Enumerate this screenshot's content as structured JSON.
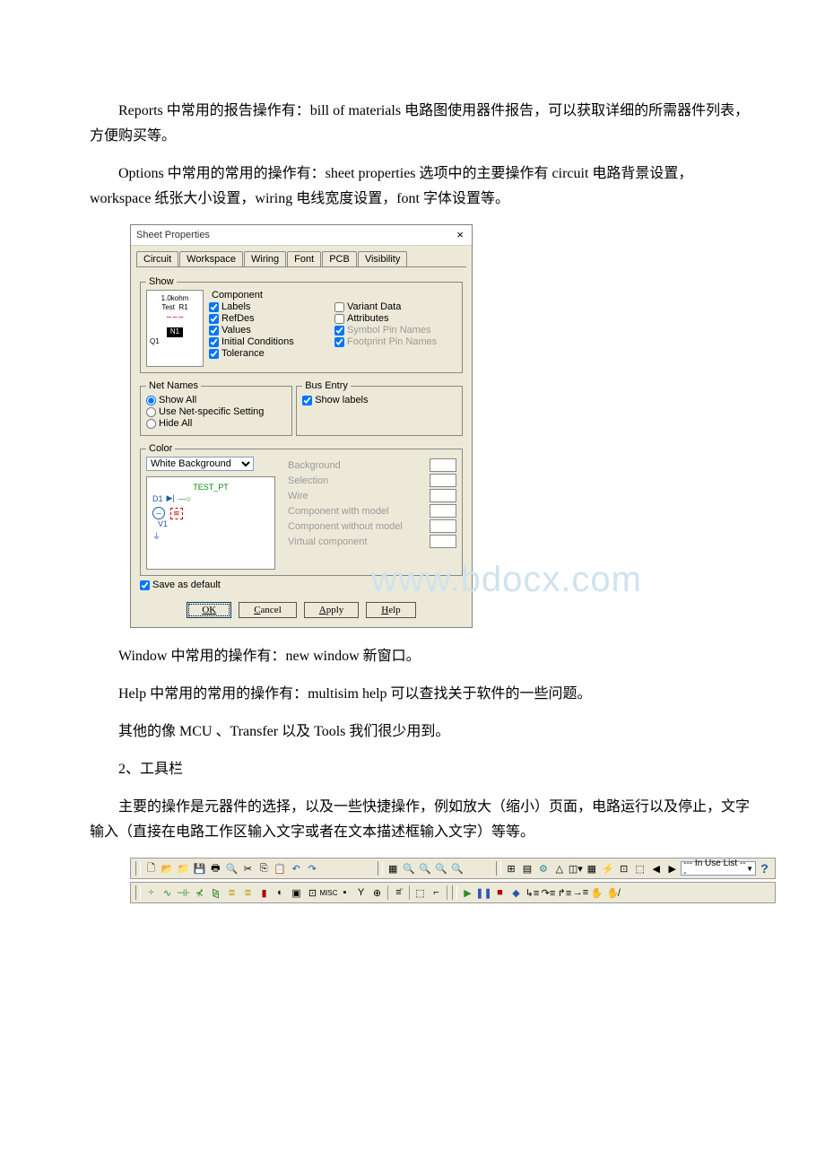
{
  "paras": {
    "p1": "Reports 中常用的报告操作有：bill of materials 电路图使用器件报告，可以获取详细的所需器件列表，方便购买等。",
    "p2": "Options 中常用的常用的操作有：sheet properties 选项中的主要操作有 circuit 电路背景设置，workspace 纸张大小设置，wiring 电线宽度设置，font 字体设置等。",
    "p3": "Window 中常用的操作有：new window 新窗口。",
    "p4": "Help 中常用的常用的操作有：multisim help 可以查找关于软件的一些问题。",
    "p5": "其他的像 MCU 、Transfer 以及 Tools 我们很少用到。",
    "p6": "2、工具栏",
    "p7": "主要的操作是元器件的选择，以及一些快捷操作，例如放大（缩小）页面，电路运行以及停止，文字输入（直接在电路工作区输入文字或者在文本描述框输入文字）等等。"
  },
  "dlg": {
    "title": "Sheet Properties",
    "close": "×",
    "tabs": [
      "Circuit",
      "Workspace",
      "Wiring",
      "Font",
      "PCB",
      "Visibility"
    ],
    "show": {
      "legend": "Show",
      "thumb": {
        "val": "1.0kohm",
        "lbl": "Test",
        "r": "R1",
        "n": "N1",
        "q": "Q1"
      },
      "comp_legend": "Component",
      "labels": "Labels",
      "refdes": "RefDes",
      "values": "Values",
      "init": "Initial Conditions",
      "tol": "Tolerance",
      "variant": "Variant Data",
      "attr": "Attributes",
      "spn": "Symbol Pin Names",
      "fpn": "Footprint Pin Names"
    },
    "net": {
      "legend": "Net Names",
      "a": "Show All",
      "b": "Use Net-specific Setting",
      "c": "Hide All"
    },
    "bus": {
      "legend": "Bus Entry",
      "show": "Show labels"
    },
    "color": {
      "legend": "Color",
      "scheme": "White Background",
      "prev": {
        "tp": "TEST_PT",
        "d": "D1",
        "v": "V1"
      },
      "items": [
        "Background",
        "Selection",
        "Wire",
        "Component with model",
        "Component without model",
        "Virtual component"
      ]
    },
    "save": "Save as default",
    "btns": {
      "ok": "OK",
      "cancel": "Cancel",
      "apply": "Apply",
      "help": "Help"
    }
  },
  "wm": "www.bdocx.com",
  "tb": {
    "inuse": "--- In Use List ---"
  }
}
